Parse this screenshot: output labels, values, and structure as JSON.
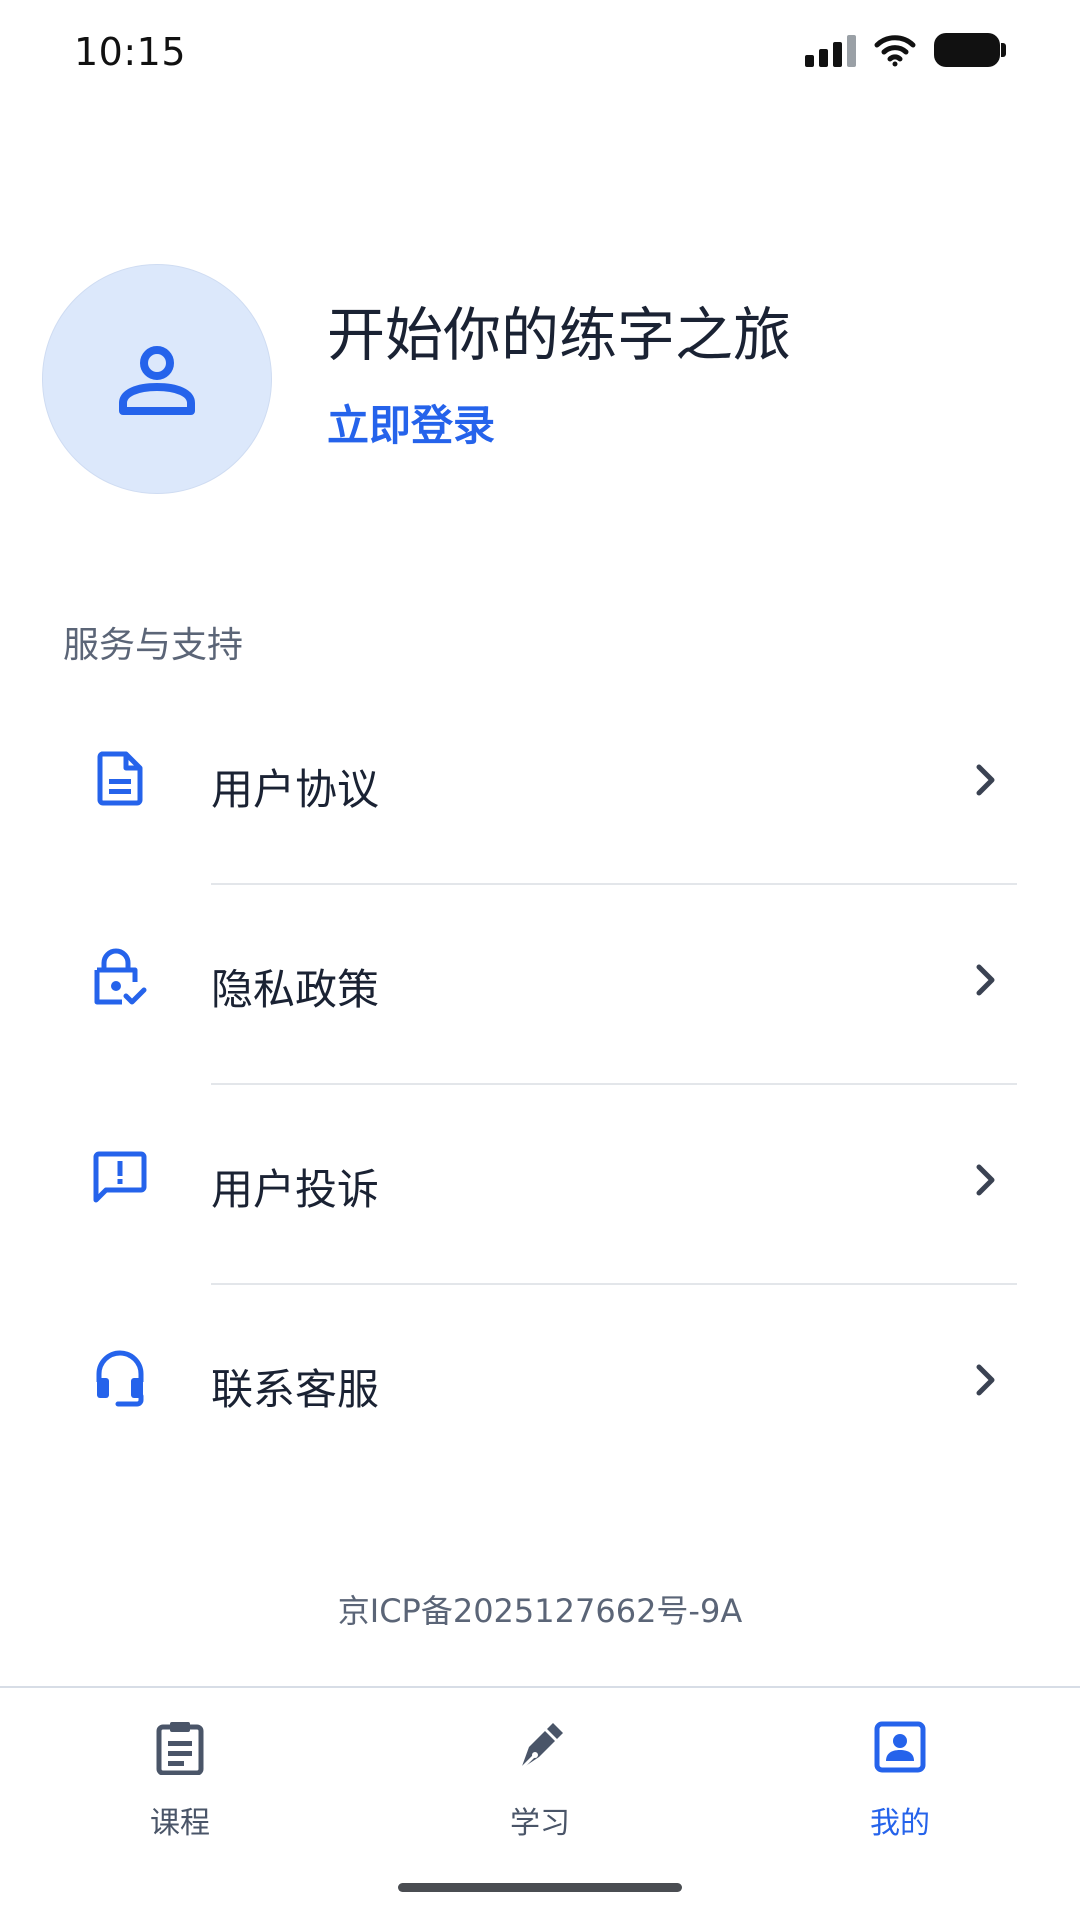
{
  "status_bar": {
    "time": "10:15"
  },
  "profile": {
    "title": "开始你的练字之旅",
    "login_label": "立即登录"
  },
  "section": {
    "label": "服务与支持"
  },
  "menu": {
    "items": [
      {
        "label": "用户协议",
        "icon": "document-icon"
      },
      {
        "label": "隐私政策",
        "icon": "privacy-lock-icon"
      },
      {
        "label": "用户投诉",
        "icon": "report-feedback-icon"
      },
      {
        "label": "联系客服",
        "icon": "headset-icon"
      }
    ]
  },
  "footer": {
    "icp": "京ICP备2025127662号-9A"
  },
  "tabbar": {
    "tabs": [
      {
        "label": "课程",
        "icon": "clipboard-icon",
        "active": false
      },
      {
        "label": "学习",
        "icon": "pen-nib-icon",
        "active": false
      },
      {
        "label": "我的",
        "icon": "profile-card-icon",
        "active": true
      }
    ]
  },
  "colors": {
    "accent": "#2563eb",
    "avatar_bg": "#dce8fb",
    "text_primary": "#1a2233",
    "text_secondary": "#5b6577"
  }
}
